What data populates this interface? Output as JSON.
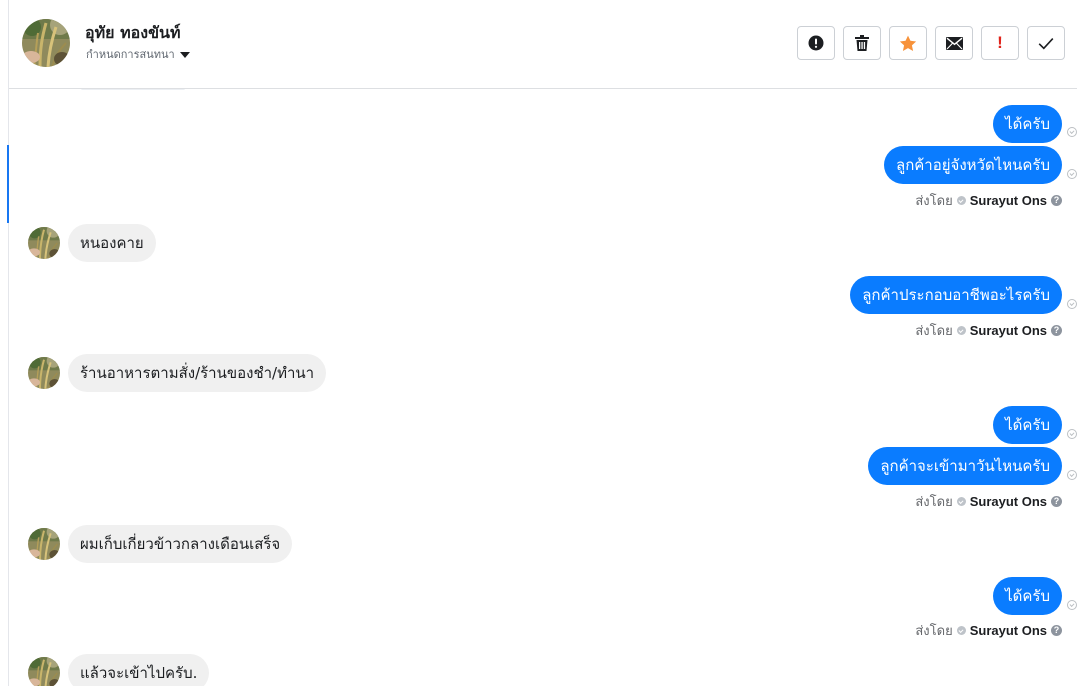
{
  "header": {
    "contact_name": "อุทัย ทองขันท์",
    "assign_label": "กำหนดการสนทนา",
    "actions": [
      {
        "name": "mark-spam-button",
        "icon": "alert-circle-icon"
      },
      {
        "name": "delete-button",
        "icon": "trash-icon"
      },
      {
        "name": "star-button",
        "icon": "star-icon"
      },
      {
        "name": "mark-unread-button",
        "icon": "envelope-icon"
      },
      {
        "name": "follow-up-button",
        "icon": "exclamation-icon",
        "label": "!"
      },
      {
        "name": "mark-done-button",
        "icon": "check-icon"
      }
    ]
  },
  "colors": {
    "outgoing_bubble": "#0a7cff",
    "incoming_bubble": "#f0f0f0",
    "star": "#f7923a",
    "exclamation": "#e0241b",
    "active_indicator": "#1877f2"
  },
  "thread": {
    "sent_by_prefix": "ส่งโดย",
    "agent_name": "Surayut Ons",
    "help_glyph": "?",
    "messages": [
      {
        "direction": "out",
        "text": "ได้ครับ"
      },
      {
        "direction": "out",
        "text": "ลูกค้าอยู่จังหวัดไหนครับ",
        "sent_by": true
      },
      {
        "direction": "in",
        "text": "หนองคาย"
      },
      {
        "direction": "out",
        "text": "ลูกค้าประกอบอาชีพอะไรครับ",
        "sent_by": true
      },
      {
        "direction": "in",
        "text": "ร้านอาหารตามสั่ง/ร้านของชำ/ทำนา"
      },
      {
        "direction": "out",
        "text": "ได้ครับ"
      },
      {
        "direction": "out",
        "text": "ลูกค้าจะเข้ามาวันไหนครับ",
        "sent_by": true
      },
      {
        "direction": "in",
        "text": "ผมเก็บเกี่ยวข้าวกลางเดือนเสร็จ"
      },
      {
        "direction": "out",
        "text": "ได้ครับ",
        "sent_by": true
      },
      {
        "direction": "in",
        "text": "แล้วจะเข้าไปครับ."
      }
    ]
  }
}
